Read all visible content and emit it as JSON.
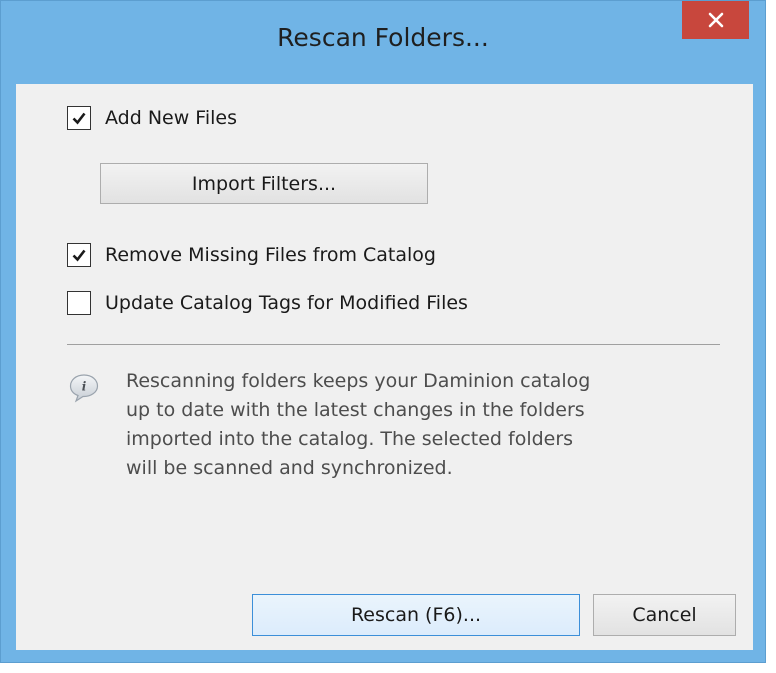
{
  "window": {
    "title": "Rescan Folders..."
  },
  "options": {
    "add_new_files": {
      "label": "Add New Files",
      "checked": true
    },
    "import_filters_label": "Import Filters...",
    "remove_missing": {
      "label": "Remove Missing Files from Catalog",
      "checked": true
    },
    "update_tags": {
      "label": "Update Catalog Tags for Modified Files",
      "checked": false
    }
  },
  "info": {
    "icon": "info-bubble-icon",
    "text": "Rescanning folders keeps your Daminion catalog up to date with the latest changes in the folders imported into the catalog. The selected folders will be scanned and synchronized."
  },
  "buttons": {
    "rescan_label": "Rescan (F6)...",
    "cancel_label": "Cancel"
  },
  "colors": {
    "titlebar": "#70b4e6",
    "close": "#c8473d",
    "client": "#f0f0f0",
    "default_button_border": "#3c8fd9"
  }
}
